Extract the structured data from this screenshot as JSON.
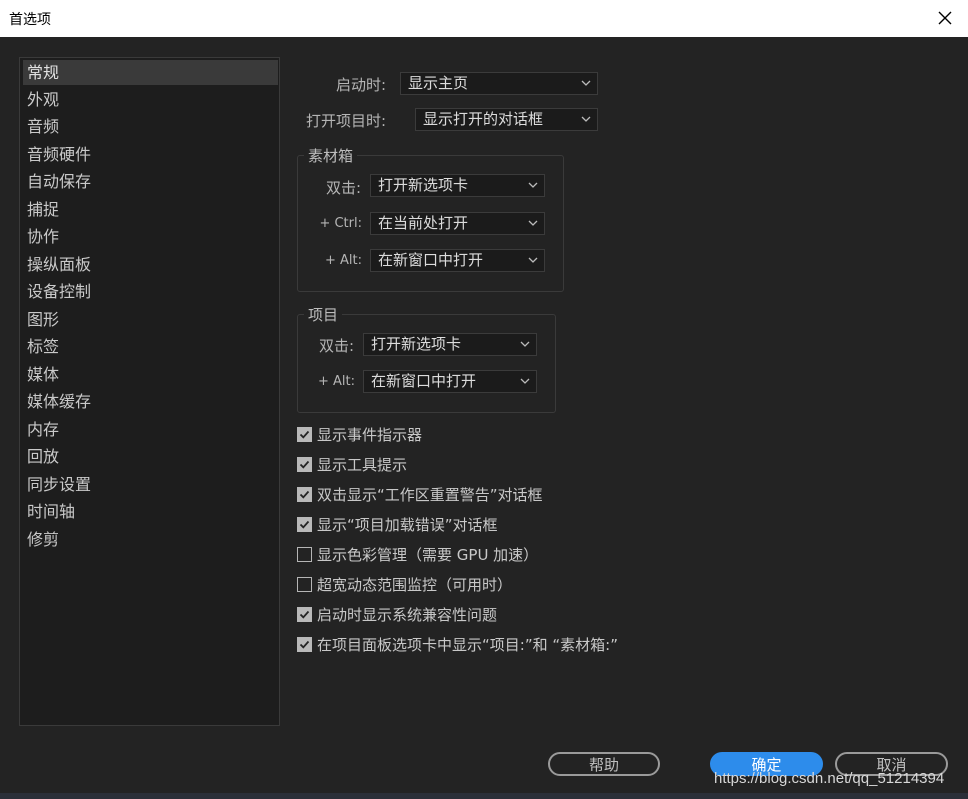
{
  "window": {
    "title": "首选项"
  },
  "sidebar": {
    "items": [
      {
        "label": "常规",
        "selected": true
      },
      {
        "label": "外观"
      },
      {
        "label": "音频"
      },
      {
        "label": "音频硬件"
      },
      {
        "label": "自动保存"
      },
      {
        "label": "捕捉"
      },
      {
        "label": "协作"
      },
      {
        "label": "操纵面板"
      },
      {
        "label": "设备控制"
      },
      {
        "label": "图形"
      },
      {
        "label": "标签"
      },
      {
        "label": "媒体"
      },
      {
        "label": "媒体缓存"
      },
      {
        "label": "内存"
      },
      {
        "label": "回放"
      },
      {
        "label": "同步设置"
      },
      {
        "label": "时间轴"
      },
      {
        "label": "修剪"
      }
    ]
  },
  "general": {
    "startup_label": "启动时:",
    "startup_value": "显示主页",
    "open_project_label": "打开项目时:",
    "open_project_value": "显示打开的对话框"
  },
  "bins": {
    "legend": "素材箱",
    "double_click_label": "双击:",
    "double_click_value": "打开新选项卡",
    "ctrl_label": "+ Ctrl:",
    "ctrl_value": "在当前处打开",
    "alt_label": "+ Alt:",
    "alt_value": "在新窗口中打开"
  },
  "project": {
    "legend": "项目",
    "double_click_label": "双击:",
    "double_click_value": "打开新选项卡",
    "alt_label": "+ Alt:",
    "alt_value": "在新窗口中打开"
  },
  "checkboxes": [
    {
      "label": "显示事件指示器",
      "checked": true
    },
    {
      "label": "显示工具提示",
      "checked": true
    },
    {
      "label": "双击显示“工作区重置警告”对话框",
      "checked": true
    },
    {
      "label": "显示“项目加载错误”对话框",
      "checked": true
    },
    {
      "label": "显示色彩管理（需要 GPU 加速）",
      "checked": false
    },
    {
      "label": "超宽动态范围监控（可用时）",
      "checked": false
    },
    {
      "label": "启动时显示系统兼容性问题",
      "checked": true
    },
    {
      "label": "在项目面板选项卡中显示“项目:”和 “素材箱:”",
      "checked": true
    }
  ],
  "buttons": {
    "help": "帮助",
    "ok": "确定",
    "cancel": "取消"
  },
  "watermark": "https://blog.csdn.net/qq_51214394",
  "colors": {
    "accent": "#2d8ceb",
    "background": "#232323",
    "panel": "#1d1d1d"
  }
}
